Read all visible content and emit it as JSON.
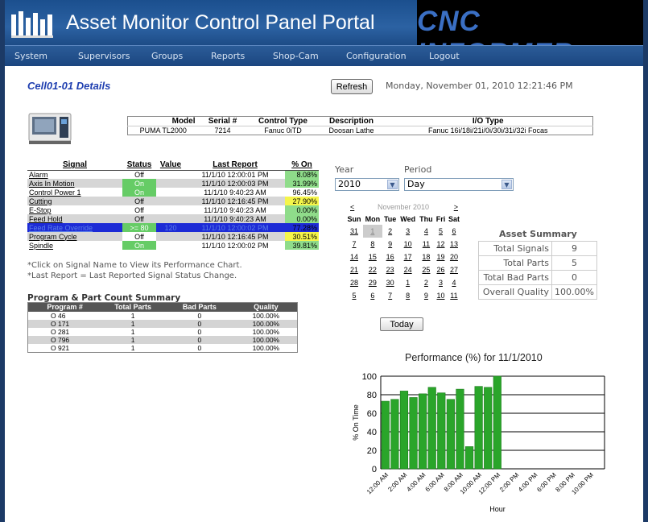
{
  "header": {
    "portal_title": "Asset Monitor Control Panel Portal",
    "brand": "CNC INFORMER"
  },
  "nav": [
    "System",
    "Supervisors",
    "Groups",
    "Reports",
    "Shop-Cam",
    "Configuration",
    "Logout"
  ],
  "page": {
    "title": "Cell01-01 Details",
    "refresh_label": "Refresh",
    "datetime": "Monday, November 01, 2010 12:21:46 PM"
  },
  "machine_info": {
    "headers": [
      "Model",
      "Serial #",
      "Control Type",
      "Description",
      "I/O Type"
    ],
    "row": [
      "PUMA TL2000",
      "7214",
      "Fanuc 0iTD",
      "Doosan Lathe",
      "Fanuc 16i/18i/21i/0i/30i/31i/32i Focas"
    ]
  },
  "signals": {
    "headers": [
      "Signal",
      "Status",
      "Value",
      "Last Report",
      "% On"
    ],
    "rows": [
      {
        "name": "Alarm",
        "status": "Off",
        "value": "",
        "last": "11/1/10 12:00:01 PM",
        "pct": "8.08%",
        "pct_color": "green"
      },
      {
        "name": "Axis In Motion",
        "status": "On",
        "value": "",
        "last": "11/1/10 12:00:03 PM",
        "pct": "31.99%",
        "pct_color": "green"
      },
      {
        "name": "Control Power 1",
        "status": "On",
        "value": "",
        "last": "11/1/10 9:40:23 AM",
        "pct": "96.45%",
        "pct_color": ""
      },
      {
        "name": "Cutting",
        "status": "Off",
        "value": "",
        "last": "11/1/10 12:16:45 PM",
        "pct": "27.90%",
        "pct_color": "yellow"
      },
      {
        "name": "E-Stop",
        "status": "Off",
        "value": "",
        "last": "11/1/10 9:40:23 AM",
        "pct": "0.00%",
        "pct_color": "green"
      },
      {
        "name": "Feed Hold",
        "status": "Off",
        "value": "",
        "last": "11/1/10 9:40:23 AM",
        "pct": "0.00%",
        "pct_color": "green"
      },
      {
        "name": "Feed Rate Override",
        "status": ">= 80",
        "value": "120",
        "last": "11/1/10 12:00:02 PM",
        "pct": "77.28%",
        "pct_color": "green"
      },
      {
        "name": "Program Cycle",
        "status": "Off",
        "value": "",
        "last": "11/1/10 12:16:45 PM",
        "pct": "30.51%",
        "pct_color": "yellow"
      },
      {
        "name": "Spindle",
        "status": "On",
        "value": "",
        "last": "11/1/10 12:00:02 PM",
        "pct": "39.81%",
        "pct_color": "green"
      }
    ],
    "note1": "*Click on Signal Name to View its Performance Chart.",
    "note2": "*Last Report = Last Reported Signal Status Change."
  },
  "program_summary": {
    "heading": "Program & Part Count Summary",
    "headers": [
      "Program #",
      "Total Parts",
      "Bad Parts",
      "Quality"
    ],
    "rows": [
      [
        "O 46",
        "1",
        "0",
        "100.00%"
      ],
      [
        "O 171",
        "1",
        "0",
        "100.00%"
      ],
      [
        "O 281",
        "1",
        "0",
        "100.00%"
      ],
      [
        "O 796",
        "1",
        "0",
        "100.00%"
      ],
      [
        "O 921",
        "1",
        "0",
        "100.00%"
      ]
    ]
  },
  "filters": {
    "year_label": "Year",
    "year_value": "2010",
    "period_label": "Period",
    "period_value": "Day"
  },
  "calendar": {
    "prev": "<",
    "next": ">",
    "month": "November 2010",
    "days": [
      "Sun",
      "Mon",
      "Tue",
      "Wed",
      "Thu",
      "Fri",
      "Sat"
    ],
    "weeks": [
      [
        "31",
        "1",
        "2",
        "3",
        "4",
        "5",
        "6"
      ],
      [
        "7",
        "8",
        "9",
        "10",
        "11",
        "12",
        "13"
      ],
      [
        "14",
        "15",
        "16",
        "17",
        "18",
        "19",
        "20"
      ],
      [
        "21",
        "22",
        "23",
        "24",
        "25",
        "26",
        "27"
      ],
      [
        "28",
        "29",
        "30",
        "1",
        "2",
        "3",
        "4"
      ],
      [
        "5",
        "6",
        "7",
        "8",
        "9",
        "10",
        "11"
      ]
    ],
    "today_label": "Today"
  },
  "asset_summary": {
    "title": "Asset Summary",
    "rows": [
      [
        "Total Signals",
        "9"
      ],
      [
        "Total Parts",
        "5"
      ],
      [
        "Total Bad Parts",
        "0"
      ],
      [
        "Overall Quality",
        "100.00%"
      ]
    ]
  },
  "colors": {
    "header_blue": "#2c62a3",
    "pct_green": "#8fdc8a",
    "pct_yellow": "#f5f54a",
    "bar_green": "#2aa52a",
    "selected_row": "#1d2bd6"
  },
  "chart_data": {
    "type": "bar",
    "title": "Performance (%) for 11/1/2010",
    "xlabel": "Hour",
    "ylabel": "% On Time",
    "ylim": [
      0,
      100
    ],
    "yticks": [
      0,
      20,
      40,
      60,
      80,
      100
    ],
    "tick_labels": [
      "12:00 AM",
      "2:00 AM",
      "4:00 AM",
      "6:00 AM",
      "8:00 AM",
      "10:00 AM",
      "12:00 PM",
      "2:00 PM",
      "4:00 PM",
      "6:00 PM",
      "8:00 PM",
      "10:00 PM"
    ],
    "values": [
      73,
      75,
      84,
      77,
      81,
      88,
      82,
      75,
      86,
      24,
      89,
      88,
      100
    ],
    "grid": true
  }
}
